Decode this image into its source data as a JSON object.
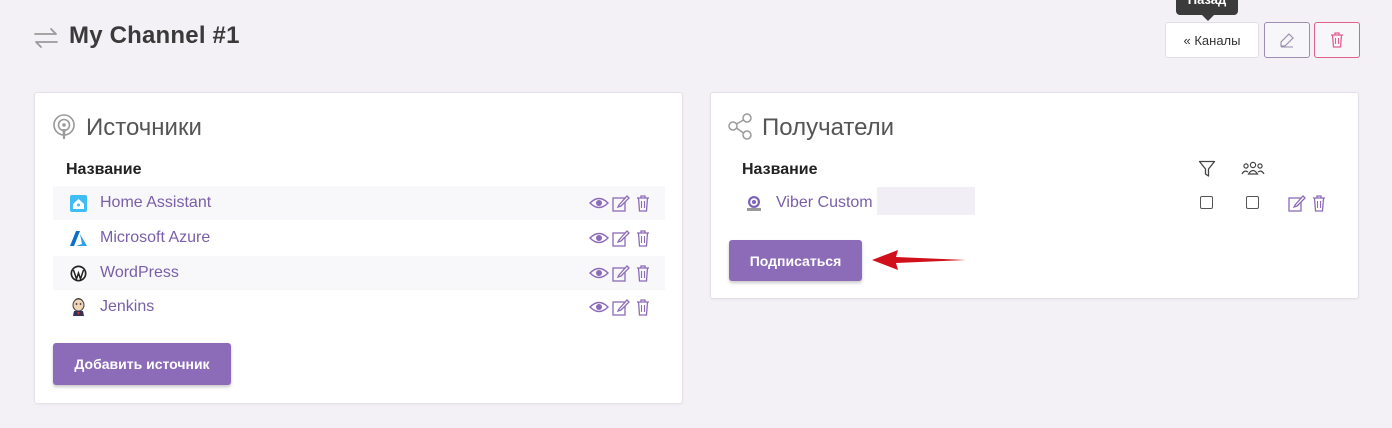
{
  "header": {
    "title": "My Channel #1",
    "tooltip": "Назад",
    "back_label": "« Каналы",
    "icons": [
      "exchange-arrows-icon",
      "edit-icon",
      "trash-icon"
    ]
  },
  "sources": {
    "title": "Источники",
    "column_name": "Название",
    "items": [
      {
        "name": "Home Assistant",
        "icon": "home-assistant-logo"
      },
      {
        "name": "Microsoft Azure",
        "icon": "azure-logo"
      },
      {
        "name": "WordPress",
        "icon": "wordpress-logo"
      },
      {
        "name": "Jenkins",
        "icon": "jenkins-logo"
      }
    ],
    "add_button": "Добавить источник"
  },
  "recipients": {
    "title": "Получатели",
    "column_name": "Название",
    "items": [
      {
        "name": "Viber Custom",
        "icon": "viber-logo",
        "filter_checked": false,
        "group_checked": false
      }
    ],
    "subscribe_button": "Подписаться"
  },
  "colors": {
    "accent": "#8c6bb8",
    "link": "#7a5fa8",
    "danger": "#e0628a",
    "arrow": "#d0101a"
  }
}
